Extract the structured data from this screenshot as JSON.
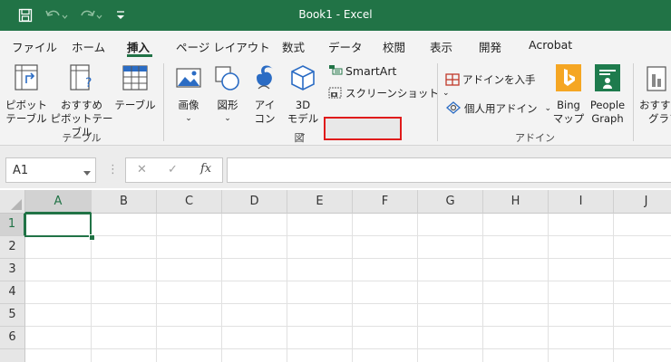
{
  "window": {
    "title": "Book1  -  Excel"
  },
  "quick_access": {
    "save": "save-icon",
    "undo": "undo-icon",
    "redo": "redo-icon",
    "customize": "customize-icon"
  },
  "tabs": [
    "ファイル",
    "ホーム",
    "挿入",
    "ページ レイアウト",
    "数式",
    "データ",
    "校閲",
    "表示",
    "開発",
    "Acrobat"
  ],
  "active_tab": "挿入",
  "ribbon": {
    "table_group": {
      "label": "テーブル",
      "pivot": {
        "line1": "ピボット",
        "line2": "テーブル"
      },
      "recommended_pivot": {
        "line1": "おすすめ",
        "line2": "ピボットテーブル"
      },
      "table": "テーブル"
    },
    "figure_group": {
      "label": "図",
      "image": "画像",
      "shapes": "図形",
      "icons": {
        "line1": "アイ",
        "line2": "コン"
      },
      "models3d": {
        "line1": "3D",
        "line2": "モデル"
      },
      "smartart": "SmartArt",
      "screenshot": "スクリーンショット"
    },
    "addin_group": {
      "label": "アドイン",
      "get_addins": "アドインを入手",
      "my_addins": "個人用アドイン",
      "bing": {
        "line1": "Bing",
        "line2": "マップ"
      },
      "people": {
        "line1": "People",
        "line2": "Graph"
      }
    },
    "recommended_chart": {
      "line1": "おすすめ",
      "line2": "グラフ"
    }
  },
  "formula_bar": {
    "name_box": "A1",
    "cancel": "✕",
    "enter": "✓",
    "fx": "fx",
    "formula": ""
  },
  "grid": {
    "columns": [
      "A",
      "B",
      "C",
      "D",
      "E",
      "F",
      "G",
      "H",
      "I",
      "J"
    ],
    "rows": [
      "1",
      "2",
      "3",
      "4",
      "5",
      "6"
    ],
    "active_cell": "A1"
  },
  "colors": {
    "excel_green": "#217346",
    "highlight": "#e01b1b"
  }
}
